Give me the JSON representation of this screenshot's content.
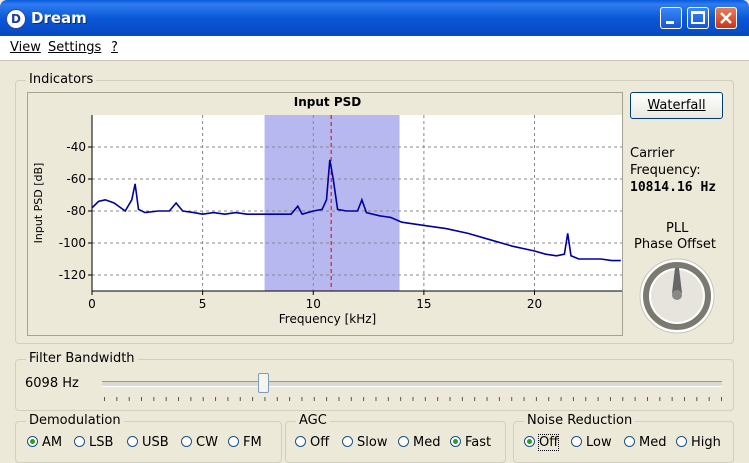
{
  "window": {
    "title": "Dream",
    "app_icon_letter": "D"
  },
  "menu": {
    "items": [
      "View",
      "Settings",
      "?"
    ]
  },
  "indicators": {
    "group_label": "Indicators",
    "waterfall_button": "Waterfall",
    "carrier_label_1": "Carrier",
    "carrier_label_2": "Frequency:",
    "carrier_value": "10814.16 Hz",
    "pll_label_1": "PLL",
    "pll_label_2": "Phase Offset"
  },
  "filter": {
    "group_label": "Filter Bandwidth",
    "value_text": "6098 Hz",
    "slider_fraction": 0.26
  },
  "demodulation": {
    "group_label": "Demodulation",
    "options": [
      "AM",
      "LSB",
      "USB",
      "CW",
      "FM"
    ],
    "selected": "AM"
  },
  "agc": {
    "group_label": "AGC",
    "options": [
      "Off",
      "Slow",
      "Med",
      "Fast"
    ],
    "selected": "Fast"
  },
  "noise_reduction": {
    "group_label": "Noise Reduction",
    "options": [
      "Off",
      "Low",
      "Med",
      "High"
    ],
    "selected": "Off"
  },
  "colors": {
    "trace": "#0000a0",
    "band_fill": "#b8b8f0",
    "marker": "#e00000",
    "titlebar": "#0a58d6"
  },
  "chart_data": {
    "type": "line",
    "title": "Input PSD",
    "xlabel": "Frequency [kHz]",
    "ylabel": "Input PSD [dB]",
    "xlim": [
      0,
      24
    ],
    "ylim": [
      -130,
      -20
    ],
    "xticks": [
      0,
      5,
      10,
      15,
      20
    ],
    "yticks": [
      -40,
      -60,
      -80,
      -100,
      -120
    ],
    "grid": true,
    "band": [
      7.8,
      13.9
    ],
    "marker_x": 10.81,
    "x": [
      0,
      0.3,
      0.6,
      1.0,
      1.5,
      1.8,
      1.95,
      2.1,
      2.4,
      3.0,
      3.5,
      3.8,
      4.1,
      4.6,
      5.0,
      5.5,
      6.0,
      6.5,
      7.0,
      7.5,
      8.0,
      8.5,
      9.0,
      9.3,
      9.5,
      10.0,
      10.4,
      10.6,
      10.75,
      10.9,
      11.1,
      11.5,
      12.0,
      12.2,
      12.4,
      13.0,
      13.5,
      14.0,
      15.0,
      16.0,
      17.0,
      18.0,
      19.0,
      20.0,
      20.5,
      21.0,
      21.35,
      21.5,
      21.65,
      22.0,
      22.5,
      23.0,
      23.5,
      23.9
    ],
    "y": [
      -78,
      -74,
      -73,
      -75,
      -80,
      -73,
      -63,
      -79,
      -81,
      -80,
      -80,
      -75,
      -80,
      -81,
      -82,
      -81,
      -82,
      -81,
      -82,
      -82,
      -82,
      -82,
      -82,
      -77,
      -82,
      -80,
      -79,
      -73,
      -48,
      -60,
      -79,
      -80,
      -80,
      -73,
      -81,
      -83,
      -84,
      -87,
      -89,
      -91,
      -94,
      -98,
      -102,
      -105,
      -107,
      -108,
      -107,
      -94,
      -108,
      -110,
      -110,
      -110,
      -111,
      -111
    ]
  }
}
